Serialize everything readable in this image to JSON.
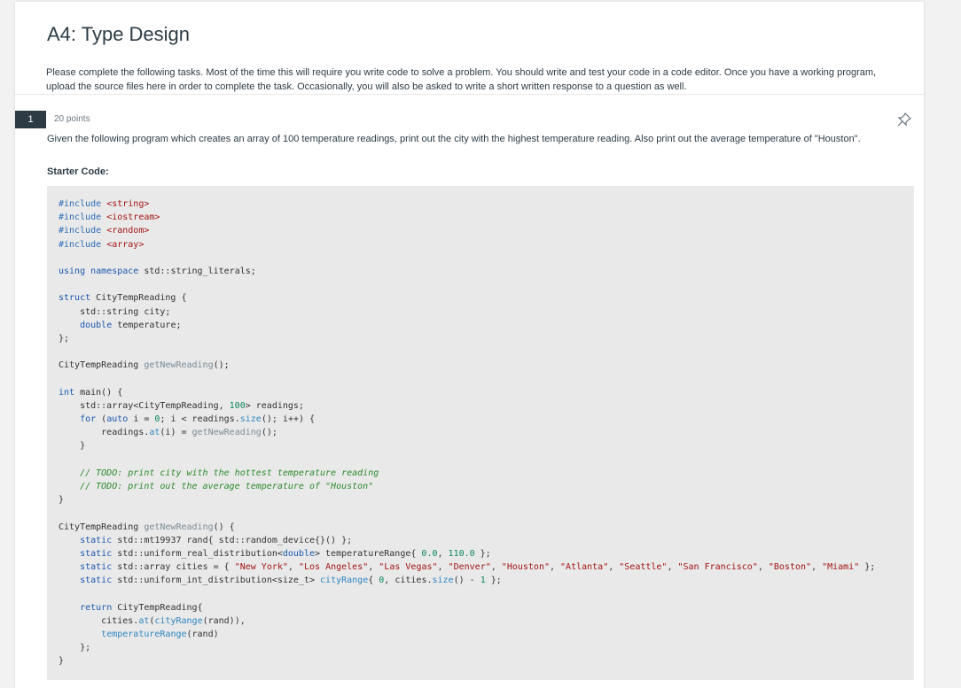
{
  "page": {
    "title": "A4: Type Design",
    "intro": "Please complete the following tasks. Most of the time this will require you write code to solve a problem. You should write and test your code in a code editor. Once you have a working program, upload the source files here in order to complete the task. Occasionally, you will also be asked to write a short written response to a question as well."
  },
  "question": {
    "number": "1",
    "points": "20 points",
    "text": "Given the following program which creates an array of 100 temperature readings, print out the city with the highest temperature reading. Also print out the average temperature of \"Houston\".",
    "starter_label": "Starter Code:"
  },
  "code_lines": [
    "#include <string>",
    "#include <iostream>",
    "#include <random>",
    "#include <array>",
    "",
    "using namespace std::string_literals;",
    "",
    "struct CityTempReading {",
    "    std::string city;",
    "    double temperature;",
    "};",
    "",
    "CityTempReading getNewReading();",
    "",
    "int main() {",
    "    std::array<CityTempReading, 100> readings;",
    "    for (auto i = 0; i < readings.size(); i++) {",
    "        readings.at(i) = getNewReading();",
    "    }",
    "",
    "    // TODO: print city with the hottest temperature reading",
    "    // TODO: print out the average temperature of \"Houston\"",
    "}",
    "",
    "CityTempReading getNewReading() {",
    "    static std::mt19937 rand{ std::random_device{}() };",
    "    static std::uniform_real_distribution<double> temperatureRange{ 0.0, 110.0 };",
    "    static std::array cities = { \"New York\", \"Los Angeles\", \"Las Vegas\", \"Denver\", \"Houston\", \"Atlanta\", \"Seattle\", \"San Francisco\", \"Boston\", \"Miami\" };",
    "    static std::uniform_int_distribution<size_t> cityRange{ 0, cities.size() - 1 };",
    "",
    "    return CityTempReading{",
    "        cities.at(cityRange(rand)),",
    "        temperatureRange(rand)",
    "    };",
    "}"
  ],
  "icons": {
    "pin": "pin-icon"
  }
}
